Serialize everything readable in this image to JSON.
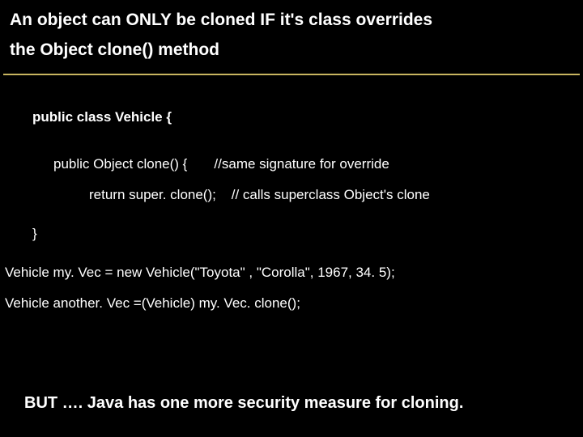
{
  "title": {
    "line1": "An object can ONLY be cloned IF it's class overrides",
    "line2": "the Object clone() method"
  },
  "code": {
    "classDecl": "public class Vehicle {",
    "methodDecl": "public Object clone() {       //same signature for override",
    "returnLine": "return super. clone();    // calls superclass Object's clone",
    "closeBrace": "}",
    "usage1": "Vehicle my. Vec = new Vehicle(\"Toyota\" , \"Corolla\", 1967, 34. 5);",
    "usage2": "Vehicle another. Vec =(Vehicle) my. Vec. clone();"
  },
  "footer": "BUT ….  Java has one more security measure for cloning."
}
